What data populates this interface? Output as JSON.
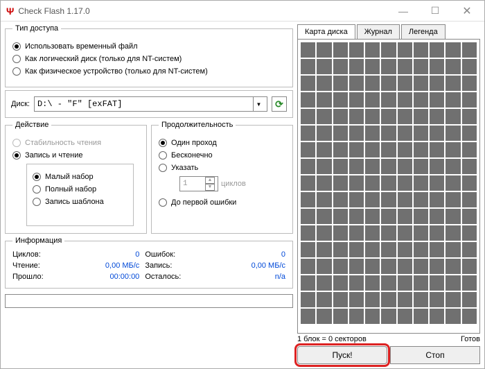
{
  "window": {
    "title": "Check Flash 1.17.0"
  },
  "access_type": {
    "legend": "Тип доступа",
    "opt_temp": "Использовать временный файл",
    "opt_logical": "Как логический диск (только для NT-систем)",
    "opt_physical": "Как физическое устройство (только для NT-систем)"
  },
  "drive": {
    "label": "Диск:",
    "value": "D:\\ - \"F\" [exFAT]"
  },
  "action": {
    "legend": "Действие",
    "opt_read": "Стабильность чтения",
    "opt_rw": "Запись и чтение",
    "sub_small": "Малый набор",
    "sub_full": "Полный набор",
    "sub_template": "Запись шаблона"
  },
  "duration": {
    "legend": "Продолжительность",
    "opt_once": "Один проход",
    "opt_inf": "Бесконечно",
    "opt_specify": "Указать",
    "cycles_val": "1",
    "cycles_lbl": "циклов",
    "opt_first_err": "До первой ошибки"
  },
  "info": {
    "legend": "Информация",
    "cycles_lbl": "Циклов:",
    "cycles_val": "0",
    "errors_lbl": "Ошибок:",
    "errors_val": "0",
    "read_lbl": "Чтение:",
    "read_val": "0,00 МБ/с",
    "write_lbl": "Запись:",
    "write_val": "0,00 МБ/с",
    "elapsed_lbl": "Прошло:",
    "elapsed_val": "00:00:00",
    "remain_lbl": "Осталось:",
    "remain_val": "n/a"
  },
  "tabs": {
    "map": "Карта диска",
    "log": "Журнал",
    "legend": "Легенда"
  },
  "status": {
    "block_info": "1 блок = 0 секторов",
    "ready": "Готов"
  },
  "buttons": {
    "start": "Пуск!",
    "stop": "Стоп"
  }
}
